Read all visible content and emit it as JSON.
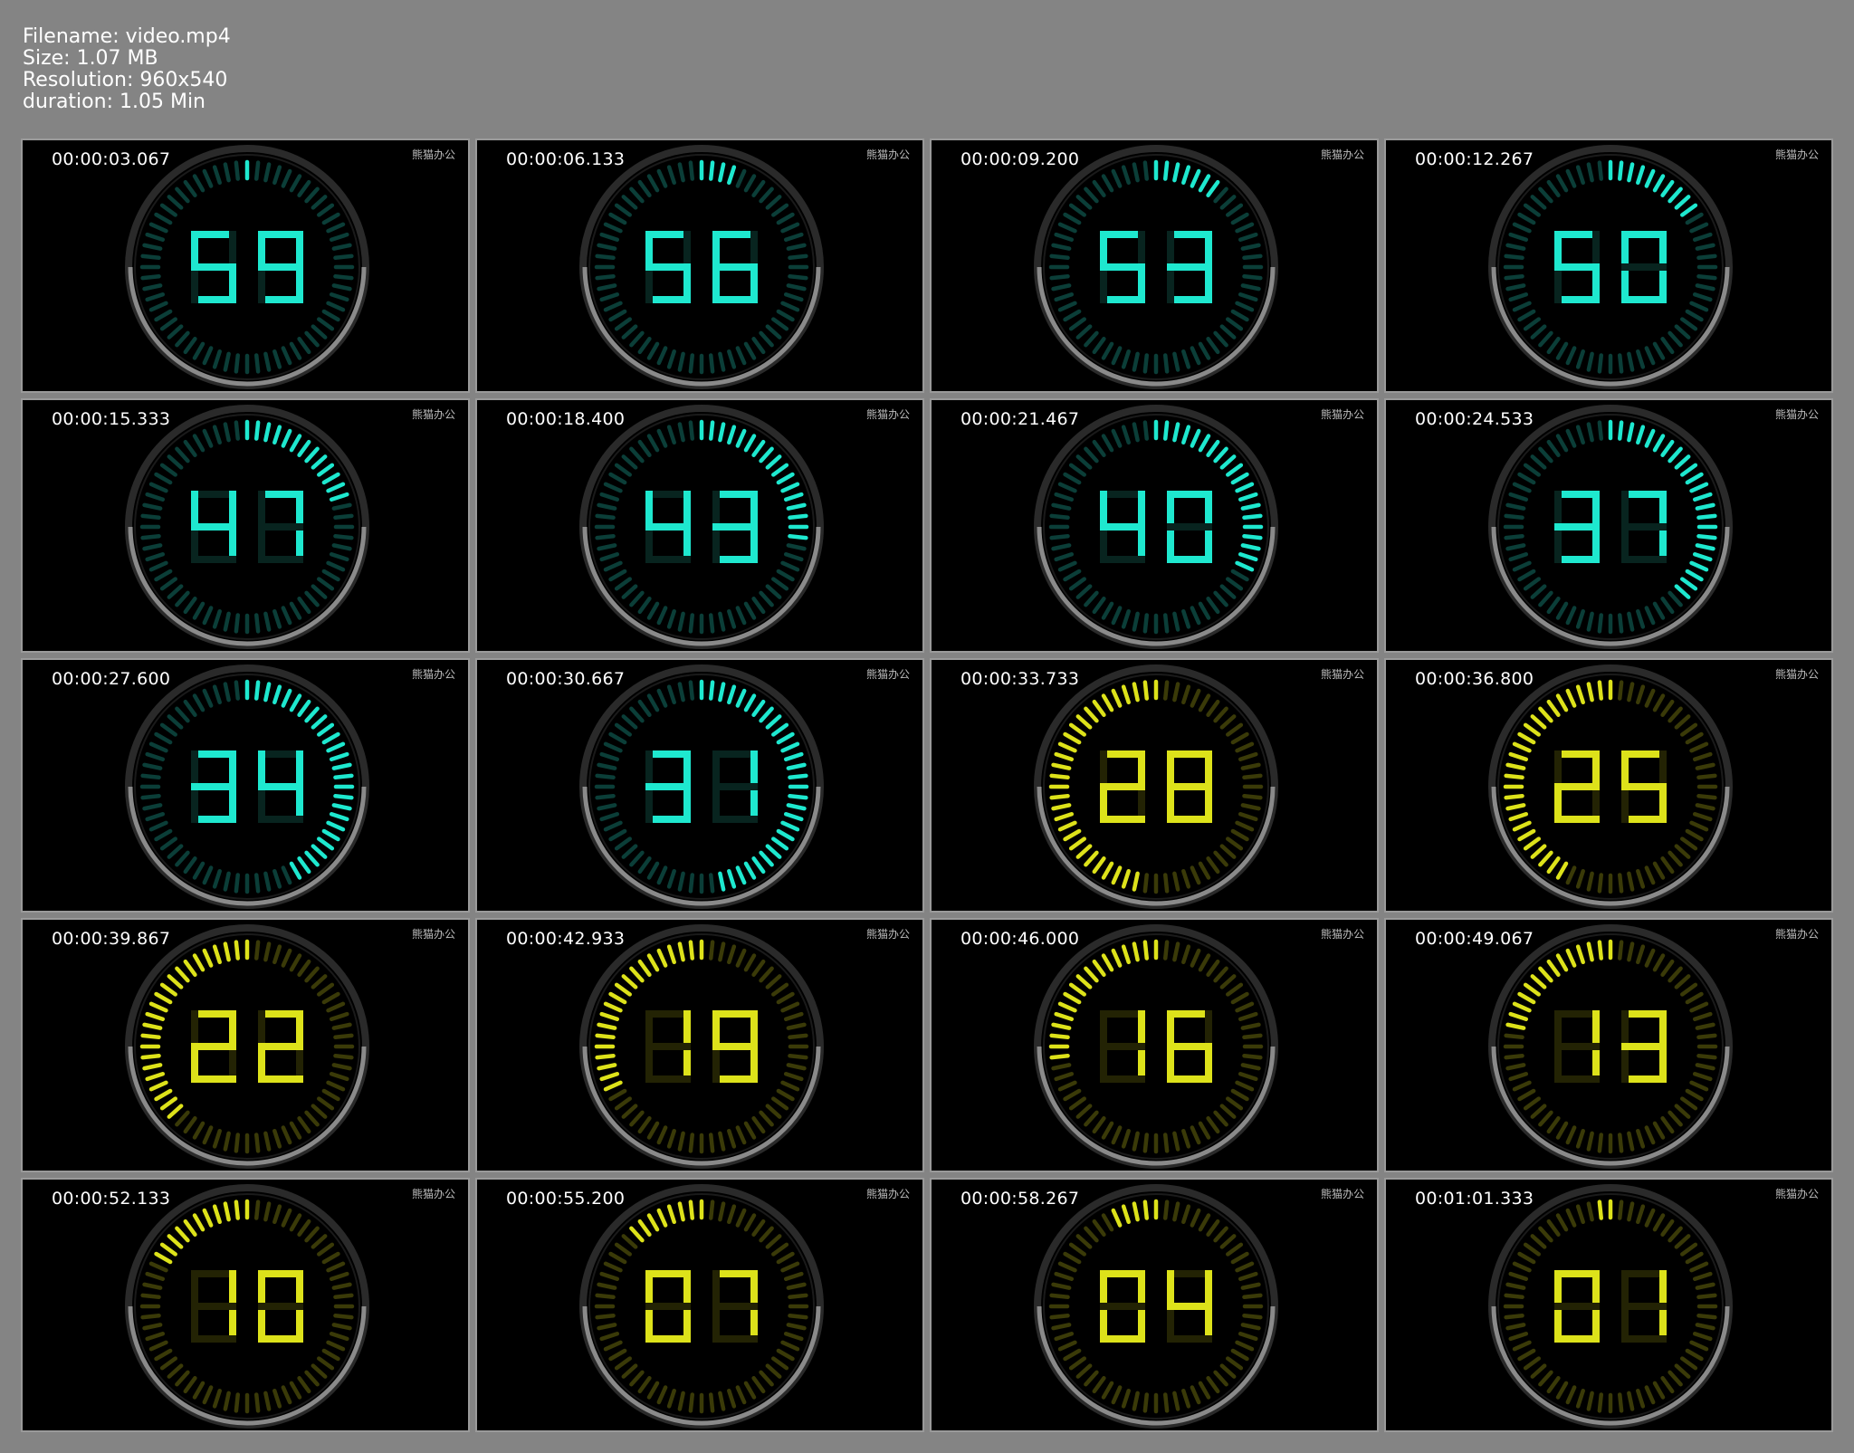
{
  "info": {
    "filename": "Filename: video.mp4",
    "size": "Size: 1.07 MB",
    "resolution": "Resolution: 960x540",
    "duration": "duration: 1.05 Min"
  },
  "colors": {
    "background": "#848484",
    "cyan": "#1ee8cf",
    "yellow": "#dde21a",
    "red": "#e4231b"
  },
  "frames": [
    {
      "timestamp": "00:00:03.067",
      "digits": "59",
      "theme": "cyan",
      "watermark": "熊猫办公"
    },
    {
      "timestamp": "00:00:06.133",
      "digits": "56",
      "theme": "cyan",
      "watermark": "熊猫办公"
    },
    {
      "timestamp": "00:00:09.200",
      "digits": "53",
      "theme": "cyan",
      "watermark": "熊猫办公"
    },
    {
      "timestamp": "00:00:12.267",
      "digits": "50",
      "theme": "cyan",
      "watermark": "熊猫办公"
    },
    {
      "timestamp": "00:00:15.333",
      "digits": "47",
      "theme": "cyan",
      "watermark": "熊猫办公"
    },
    {
      "timestamp": "00:00:18.400",
      "digits": "43",
      "theme": "cyan",
      "watermark": "熊猫办公"
    },
    {
      "timestamp": "00:00:21.467",
      "digits": "40",
      "theme": "cyan",
      "watermark": "熊猫办公"
    },
    {
      "timestamp": "00:00:24.533",
      "digits": "37",
      "theme": "cyan",
      "watermark": "熊猫办公"
    },
    {
      "timestamp": "00:00:27.600",
      "digits": "34",
      "theme": "cyan",
      "watermark": "熊猫办公"
    },
    {
      "timestamp": "00:00:30.667",
      "digits": "31",
      "theme": "cyan",
      "watermark": "熊猫办公"
    },
    {
      "timestamp": "00:00:33.733",
      "digits": "28",
      "theme": "yellow",
      "watermark": "熊猫办公"
    },
    {
      "timestamp": "00:00:36.800",
      "digits": "25",
      "theme": "yellow",
      "watermark": "熊猫办公"
    },
    {
      "timestamp": "00:00:39.867",
      "digits": "22",
      "theme": "yellow",
      "watermark": "熊猫办公"
    },
    {
      "timestamp": "00:00:42.933",
      "digits": "19",
      "theme": "yellow",
      "watermark": "熊猫办公"
    },
    {
      "timestamp": "00:00:46.000",
      "digits": "16",
      "theme": "yellow",
      "watermark": "熊猫办公"
    },
    {
      "timestamp": "00:00:49.067",
      "digits": "13",
      "theme": "yellow",
      "watermark": "熊猫办公"
    },
    {
      "timestamp": "00:00:52.133",
      "digits": "10",
      "theme": "yellow",
      "watermark": "熊猫办公"
    },
    {
      "timestamp": "00:00:55.200",
      "digits": "07",
      "theme": "yellow",
      "watermark": "熊猫办公"
    },
    {
      "timestamp": "00:00:58.267",
      "digits": "04",
      "theme": "yellow",
      "watermark": "熊猫办公"
    },
    {
      "timestamp": "00:01:01.333",
      "digits": "01",
      "theme": "yellow",
      "watermark": "熊猫办公"
    }
  ]
}
